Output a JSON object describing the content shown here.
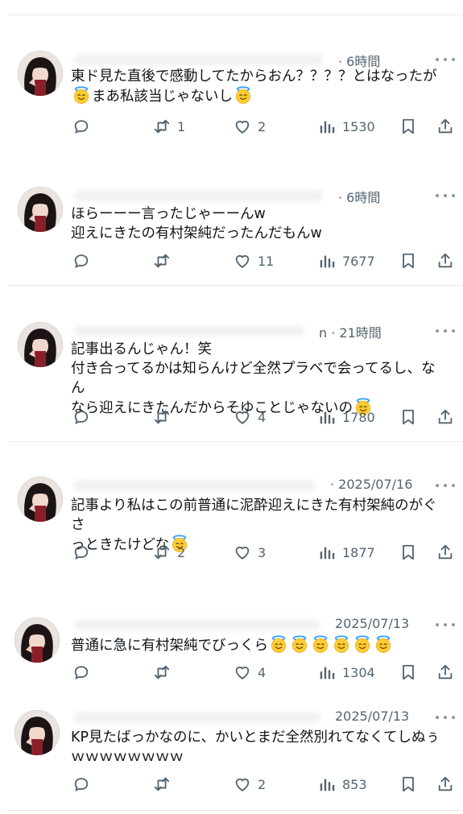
{
  "icons": {
    "reply": "reply-icon",
    "repost": "repost-icon",
    "like": "heart-icon",
    "views": "views-icon",
    "bookmark": "bookmark-icon",
    "share": "share-icon",
    "more": "more-icon",
    "emoji": "smiling-face-with-halo-emoji"
  },
  "posts": [
    {
      "time": "· 6時間",
      "lines": [
        "東ド見た直後で感動してたからおん？？？？とはなったが",
        "{halo}まあ私該当じゃないし{halo}"
      ],
      "replies": "",
      "reposts": "1",
      "likes": "2",
      "views": "1530"
    },
    {
      "time": "· 6時間",
      "lines": [
        "ほらーーー言ったじゃーーんw",
        "迎えにきたの有村架純だったんだもんw"
      ],
      "replies": "",
      "reposts": "",
      "likes": "11",
      "views": "7677"
    },
    {
      "time": "n · 21時間",
      "lines": [
        "記事出るんじゃん！笑",
        "付き合ってるかは知らんけど全然プラベで会ってるし、なん",
        "なら迎えにきたんだからそゆことじゃないの{halo}"
      ],
      "replies": "",
      "reposts": "",
      "likes": "4",
      "views": "1780"
    },
    {
      "time": "· 2025/07/16",
      "lines": [
        "記事より私はこの前普通に泥酔迎えにきた有村架純のがぐさ",
        "っときたけどな{halo}"
      ],
      "replies": "",
      "reposts": "2",
      "likes": "3",
      "views": "1877"
    },
    {
      "time": "2025/07/13",
      "lines": [
        "普通に急に有村架純でびっくら{halo}{halo}{halo}{halo}{halo}{halo}"
      ],
      "replies": "",
      "reposts": "",
      "likes": "4",
      "views": "1304"
    },
    {
      "time": "2025/07/13",
      "lines": [
        "KP見たばっかなのに、かいとまだ全然別れてなくてしぬぅ",
        "ｗｗｗｗｗｗｗｗ"
      ],
      "replies": "",
      "reposts": "",
      "likes": "2",
      "views": "853"
    }
  ]
}
